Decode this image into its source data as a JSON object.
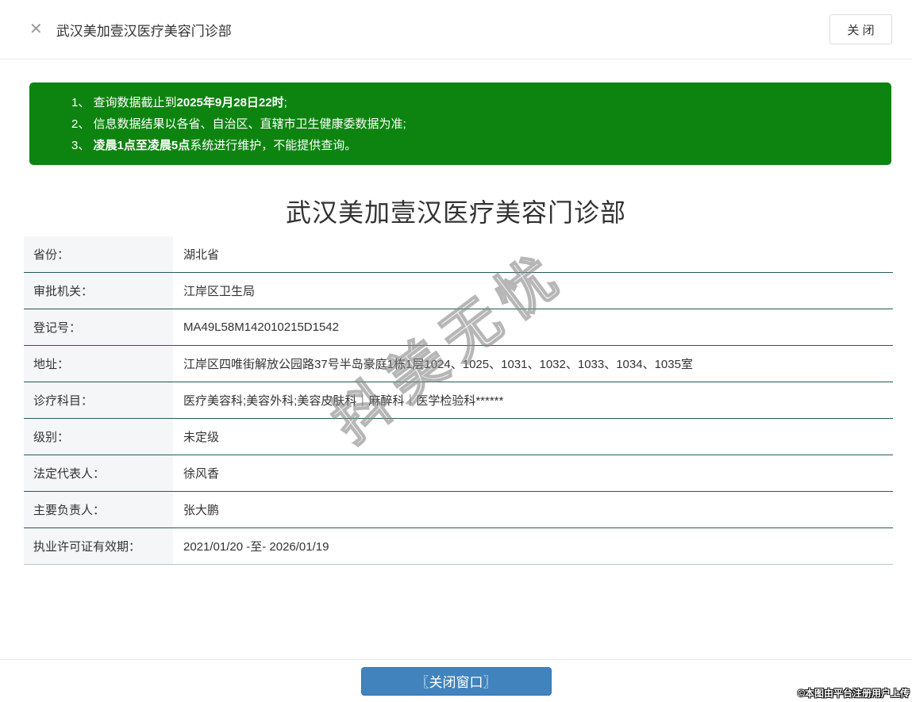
{
  "header": {
    "close_icon": "✕",
    "title": "武汉美加壹汉医疗美容门诊部",
    "close_button_label": "关 闭"
  },
  "notice": {
    "bg_color": "#0e8410",
    "lines": [
      {
        "segments": [
          {
            "text": "1、 查询数据截止到",
            "bold": false
          },
          {
            "text": "2025年9月28日22时",
            "bold": true
          },
          {
            "text": ";",
            "bold": false
          }
        ]
      },
      {
        "segments": [
          {
            "text": "2、 信息数据结果以各省、自治区、直辖市卫生健康委数据为准;",
            "bold": false
          }
        ]
      },
      {
        "segments": [
          {
            "text": "3、 ",
            "bold": false
          },
          {
            "text": "凌晨1点至凌晨5点",
            "bold": true
          },
          {
            "text": "系统进行维护，不能提供查询。",
            "bold": false
          }
        ]
      }
    ]
  },
  "main": {
    "institution_title": "武汉美加壹汉医疗美容门诊部"
  },
  "info_table": {
    "border_color": "#235b5b",
    "rows": [
      {
        "label": "省份：",
        "value": "湖北省"
      },
      {
        "label": "审批机关：",
        "value": "江岸区卫生局"
      },
      {
        "label": "登记号：",
        "value": "MA49L58M142010215D1542"
      },
      {
        "label": "地址：",
        "value": "江岸区四唯街解放公园路37号半岛豪庭1栋1层1024、1025、1031、1032、1033、1034、1035室"
      },
      {
        "label": "诊疗科目：",
        "value": "医疗美容科;美容外科;美容皮肤科｜麻醉科｜医学检验科******"
      },
      {
        "label": "级别：",
        "value": "未定级"
      },
      {
        "label": "法定代表人：",
        "value": "徐风香"
      },
      {
        "label": "主要负责人：",
        "value": "张大鹏"
      },
      {
        "label": "执业许可证有效期：",
        "value": "2021/01/20 -至- 2026/01/19"
      }
    ]
  },
  "watermark": {
    "text": "抖美无忧"
  },
  "footer": {
    "close_window_label": "〖关闭窗口〗",
    "button_color": "#4083bd"
  },
  "credit": {
    "text": "©本图由平台注册用户上传"
  }
}
